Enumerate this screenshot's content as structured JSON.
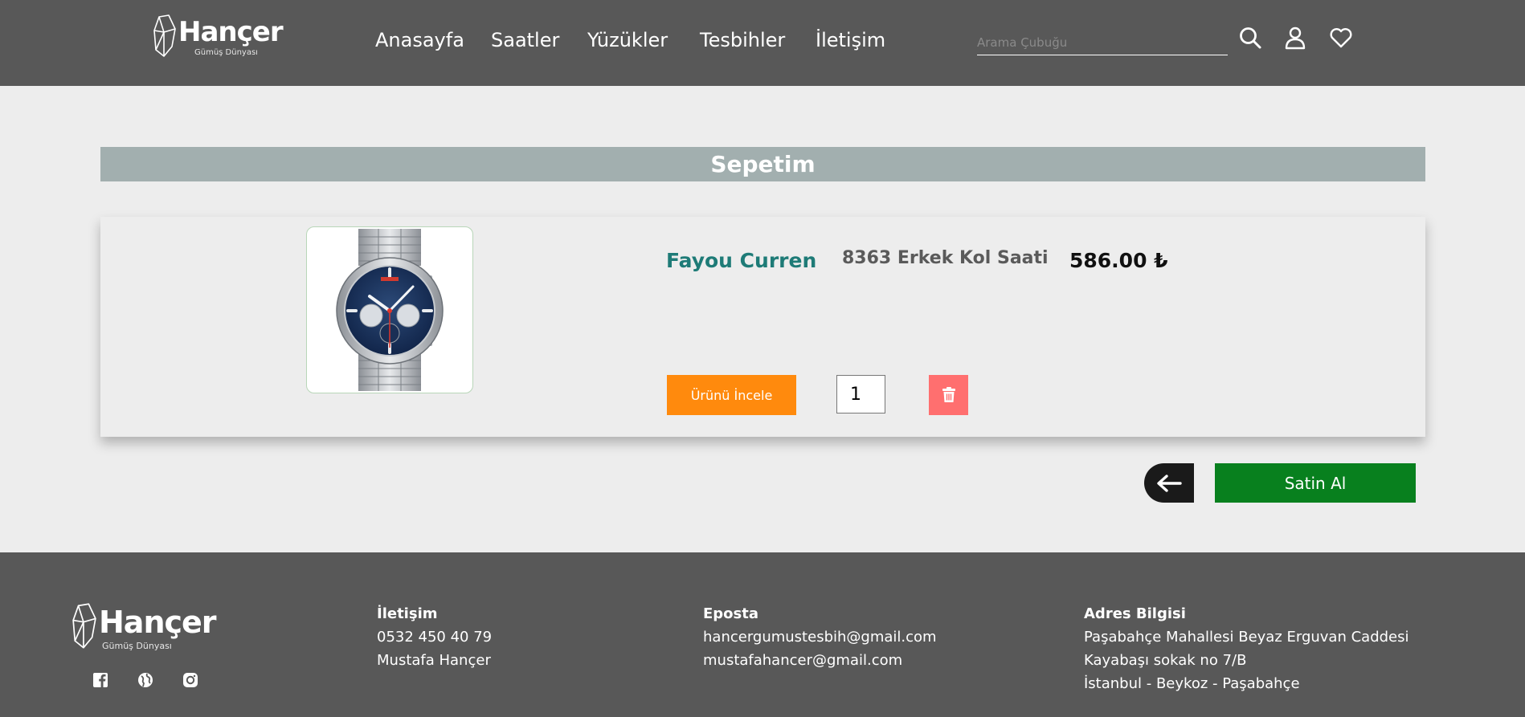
{
  "header": {
    "logo": {
      "brand": "Hançer",
      "tagline": "Gümüş Dünyası"
    },
    "nav": [
      "Anasayfa",
      "Saatler",
      "Yüzükler",
      "Tesbihler",
      "İletişim"
    ],
    "search_placeholder": "Arama Çubuğu",
    "icons": [
      "search-icon",
      "user-icon",
      "heart-icon"
    ]
  },
  "cart": {
    "title": "Sepetim",
    "items": [
      {
        "brand": "Fayou Curren",
        "model": "8363 Erkek Kol Saati",
        "price": "586.00 ₺",
        "inspect_label": "Ürünü İncele",
        "quantity": "1"
      }
    ],
    "buy_label": "Satin Al"
  },
  "footer": {
    "logo": {
      "brand": "Hançer",
      "tagline": "Gümüş Dünyası"
    },
    "social_icons": [
      "facebook-icon",
      "globe-icon",
      "instagram-icon"
    ],
    "contact": {
      "title": "İletişim",
      "phone": "0532 450 40 79",
      "name": "Mustafa Hançer"
    },
    "email": {
      "title": "Eposta",
      "lines": [
        "hancergumustesbih@gmail.com",
        "mustafahancer@gmail.com"
      ]
    },
    "address": {
      "title": "Adres Bilgisi",
      "lines": [
        "Paşabahçe Mahallesi Beyaz Erguvan Caddesi",
        "Kayabaşı sokak no 7/B",
        "İstanbul - Beykoz - Paşabahçe"
      ]
    }
  },
  "colors": {
    "header_bg": "#585858",
    "page_bg": "#ededed",
    "title_bar": "#a2afaf",
    "brand_teal": "#1e7b77",
    "inspect_orange": "#ff8a0d",
    "delete_red": "#ff6f6f",
    "buy_green": "#08801e"
  }
}
